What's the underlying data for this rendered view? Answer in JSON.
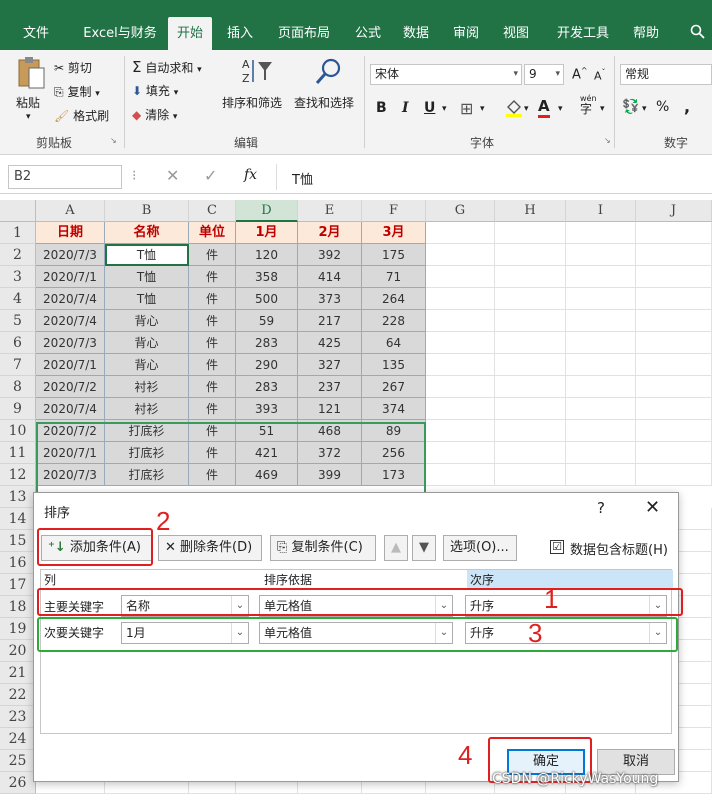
{
  "ribbon_tabs": [
    "文件",
    "Excel与财务",
    "开始",
    "插入",
    "页面布局",
    "公式",
    "数据",
    "审阅",
    "视图",
    "开发工具",
    "帮助"
  ],
  "clipboard": {
    "paste": "粘贴",
    "cut": "剪切",
    "copy": "复制",
    "format_painter": "格式刷",
    "group": "剪贴板"
  },
  "editing": {
    "autosum": "自动求和",
    "fill": "填充",
    "clear": "清除",
    "sort_filter": "排序和筛选",
    "find_select": "查找和选择",
    "group": "编辑"
  },
  "font": {
    "name": "宋体",
    "size": "9",
    "group": "字体",
    "bold": "B",
    "italic": "I",
    "underline": "U",
    "grow": "A",
    "shrink": "A",
    "wen": "wén",
    "zi": "字"
  },
  "number": {
    "format": "常规",
    "group": "数字",
    "percent": "%",
    "comma": ","
  },
  "formula_bar": {
    "name_box": "B2",
    "fx": "fx",
    "content": "T恤"
  },
  "columns": [
    "A",
    "B",
    "C",
    "D",
    "E",
    "F",
    "G",
    "H",
    "I",
    "J"
  ],
  "rows": [
    "1",
    "2",
    "3",
    "4",
    "5",
    "6",
    "7",
    "8",
    "9",
    "10",
    "11",
    "12",
    "13",
    "14",
    "15",
    "16",
    "17",
    "18",
    "19",
    "20",
    "21",
    "22",
    "23",
    "24",
    "25",
    "26"
  ],
  "table": {
    "headers": [
      "日期",
      "名称",
      "单位",
      "1月",
      "2月",
      "3月"
    ],
    "rows": [
      [
        "2020/7/3",
        "T恤",
        "件",
        "120",
        "392",
        "175"
      ],
      [
        "2020/7/1",
        "T恤",
        "件",
        "358",
        "414",
        "71"
      ],
      [
        "2020/7/4",
        "T恤",
        "件",
        "500",
        "373",
        "264"
      ],
      [
        "2020/7/4",
        "背心",
        "件",
        "59",
        "217",
        "228"
      ],
      [
        "2020/7/3",
        "背心",
        "件",
        "283",
        "425",
        "64"
      ],
      [
        "2020/7/1",
        "背心",
        "件",
        "290",
        "327",
        "135"
      ],
      [
        "2020/7/2",
        "衬衫",
        "件",
        "283",
        "237",
        "267"
      ],
      [
        "2020/7/4",
        "衬衫",
        "件",
        "393",
        "121",
        "374"
      ],
      [
        "2020/7/2",
        "打底衫",
        "件",
        "51",
        "468",
        "89"
      ],
      [
        "2020/7/1",
        "打底衫",
        "件",
        "421",
        "372",
        "256"
      ],
      [
        "2020/7/3",
        "打底衫",
        "件",
        "469",
        "399",
        "173"
      ]
    ]
  },
  "dialog": {
    "title": "排序",
    "help": "?",
    "close": "✕",
    "add_condition": "添加条件(A)",
    "delete_condition": "删除条件(D)",
    "copy_condition": "复制条件(C)",
    "options": "选项(O)...",
    "has_headers_label": "数据包含标题(H)",
    "has_headers_checked": "☑",
    "col_header": "列",
    "sort_on_header": "排序依据",
    "order_header": "次序",
    "primary": {
      "label": "主要关键字",
      "column": "名称",
      "sort_on": "单元格值",
      "order": "升序"
    },
    "secondary": {
      "label": "次要关键字",
      "column": "1月",
      "sort_on": "单元格值",
      "order": "升序"
    },
    "ok": "确定",
    "cancel": "取消"
  },
  "annotations": [
    "2",
    "1",
    "3",
    "4"
  ],
  "watermark": "CSDN @RickyWasYoung",
  "colors": {
    "excel_green": "#217346",
    "annotation_red": "#e02020",
    "annotation_green": "#2eaa3a",
    "header_text": "#c00000"
  }
}
